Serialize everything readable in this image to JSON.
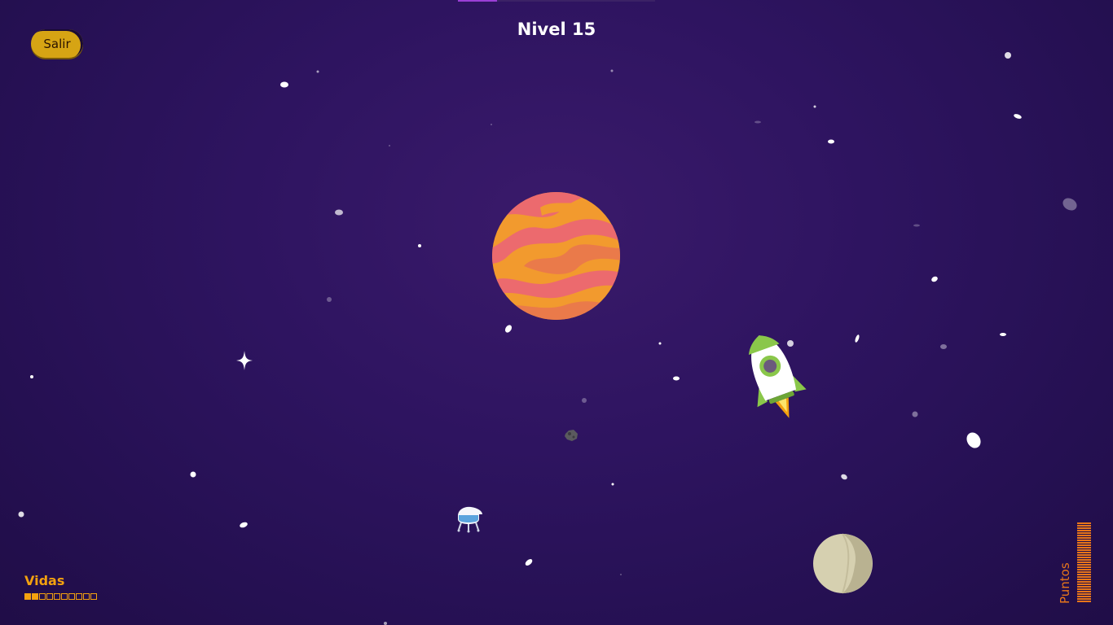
{
  "game": {
    "level_label": "Nivel 15",
    "exit_label": "Salir",
    "level_progress_fraction": 0.2
  },
  "hud": {
    "lives_label": "Vidas",
    "lives_total": 10,
    "lives_remaining": 2,
    "points_label": "Puntos",
    "points_ticks": 33
  },
  "colors": {
    "accent_yellow": "#d6a414",
    "lives_orange": "#f3a10f",
    "points_orange": "#e8761a",
    "background": "#2e1460"
  },
  "sprites": {
    "planet_large": "orange-striped-planet",
    "planet_small": "beige-moon",
    "player": "white-green-rocket",
    "enemy_ufo": "ufo-lander",
    "asteroid": "gray-asteroid",
    "sparkle": "four-point-star"
  }
}
